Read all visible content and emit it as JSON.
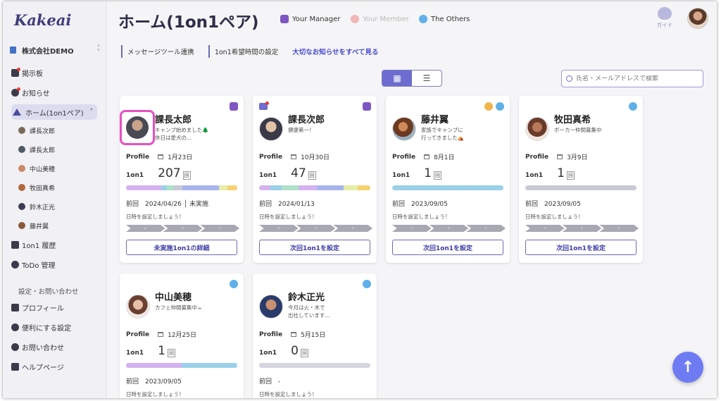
{
  "app": {
    "logo": "Kakeai"
  },
  "sidebar": {
    "company": "株式会社DEMO",
    "items": [
      {
        "label": "掲示板"
      },
      {
        "label": "お知らせ"
      },
      {
        "label": "ホーム(1on1ペア)"
      },
      {
        "label": "1on1 履歴"
      },
      {
        "label": "ToDo 管理"
      }
    ],
    "sub_items": [
      {
        "label": "課長次郎"
      },
      {
        "label": "課長太郎"
      },
      {
        "label": "中山美穂"
      },
      {
        "label": "牧田真希"
      },
      {
        "label": "鈴木正光"
      },
      {
        "label": "藤井翼"
      }
    ],
    "settings_label": "設定・お問い合わせ",
    "settings_items": [
      {
        "label": "プロフィール"
      },
      {
        "label": "便利にする設定"
      },
      {
        "label": "お問い合わせ"
      },
      {
        "label": "ヘルプページ"
      }
    ]
  },
  "header": {
    "title": "ホーム(1on1ペア)",
    "legend": [
      {
        "label": "Your Manager",
        "color": "#7e57c2"
      },
      {
        "label": "Your Member",
        "color": "#f3b6b6"
      },
      {
        "label": "The Others",
        "color": "#5fb0e8"
      }
    ],
    "guide_label": "ガイド",
    "links": [
      "メッセージツール連携",
      "1on1希望時間の設定"
    ],
    "news_link": "大切なお知らせをすべて見る",
    "search_placeholder": "氏名・メールアドレスで検索"
  },
  "cards": [
    {
      "name": "課長太郎",
      "message": "キャンプ始めました🌲\n休日は愛犬の...",
      "profile_label": "Profile",
      "profile_date": "1月23日",
      "count_label": "1on1",
      "count": "207",
      "unit": "回",
      "last": "前回　2024/04/26 │ 未実施",
      "hint": "日時を設定しましょう！",
      "button": "未実施1on1の詳細"
    },
    {
      "name": "課長次郎",
      "message": "健康第一！",
      "profile_label": "Profile",
      "profile_date": "10月30日",
      "count_label": "1on1",
      "count": "47",
      "unit": "回",
      "last": "前回　2024/01/13",
      "hint": "日時を設定しましょう！",
      "button": "次回1on1を設定"
    },
    {
      "name": "藤井翼",
      "message": "家族でキャンプに\n行ってきました⛺",
      "profile_label": "Profile",
      "profile_date": "8月1日",
      "count_label": "1on1",
      "count": "1",
      "unit": "回",
      "last": "前回　2023/09/05",
      "hint": "日時を設定しましょう！",
      "button": "次回1on1を設定"
    },
    {
      "name": "牧田真希",
      "message": "ポーカー仲間募集中",
      "profile_label": "Profile",
      "profile_date": "3月9日",
      "count_label": "1on1",
      "count": "1",
      "unit": "回",
      "last": "前回　2023/09/05",
      "hint": "日時を設定しましょう！",
      "button": "次回1on1を設定"
    },
    {
      "name": "中山美穂",
      "message": "カフェ仲間募集中☕",
      "profile_label": "Profile",
      "profile_date": "12月25日",
      "count_label": "1on1",
      "count": "1",
      "unit": "回",
      "last": "前回　2023/09/05",
      "hint": "日時を設定しましょう！",
      "button": ""
    },
    {
      "name": "鈴木正光",
      "message": "今月は火・木で\n出社しています...",
      "profile_label": "Profile",
      "profile_date": "5月15日",
      "count_label": "1on1",
      "count": "0",
      "unit": "回",
      "last": "前回　-",
      "hint": "日時を設定しましょう！",
      "button": ""
    }
  ],
  "chevron_mark": "✓",
  "view_icons": {
    "grid": "▦",
    "list": "☰"
  },
  "fab_icon": "↑"
}
